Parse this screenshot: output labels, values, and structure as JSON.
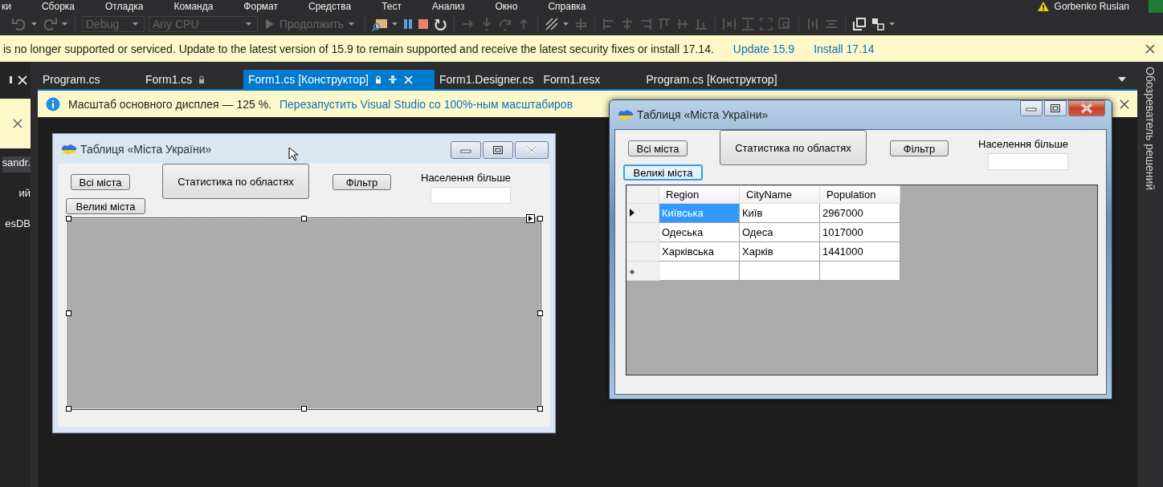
{
  "menu": [
    "ки",
    "Сборка",
    "Отладка",
    "Команда",
    "Формат",
    "Средства",
    "Тест",
    "Анализ",
    "Окно",
    "Справка"
  ],
  "user": {
    "name": "Gorbenko Ruslan"
  },
  "toolbar": {
    "configuration": "Debug",
    "platform": "Any CPU",
    "continue": "Продолжить"
  },
  "notification": {
    "text": "is no longer supported or serviced. Update to the latest version of 15.9 to remain supported and receive the latest security fixes or install 17.14.",
    "links": [
      "Update 15.9",
      "Install 17.14"
    ]
  },
  "left_panel": {
    "items": [
      {
        "text": "sandr.",
        "selected": true
      },
      {
        "text": "ий",
        "selected": false
      },
      {
        "text": "esDB",
        "selected": false
      }
    ]
  },
  "tabs": [
    {
      "label": "Program.cs",
      "selected": false,
      "locked": false
    },
    {
      "label": "Form1.cs",
      "selected": false,
      "locked": true
    },
    {
      "label": "Form1.cs [Конструктор]",
      "selected": true,
      "locked": true
    },
    {
      "label": "Form1.Designer.cs",
      "selected": false,
      "locked": false
    },
    {
      "label": "Form1.resx",
      "selected": false,
      "locked": false
    },
    {
      "label": "Program.cs [Конструктор]",
      "selected": false,
      "locked": false
    }
  ],
  "info_bar": {
    "text": "Масштаб основного дисплея — 125 %.",
    "link": "Перезапустить Visual Studio со 100%-ным масштабиров"
  },
  "side_panel": {
    "title": "Обозреватель решений"
  },
  "windows": [
    {
      "kind": "designer",
      "title": "Таблиця «Міста України»",
      "buttons": [
        {
          "label": "Всі міста",
          "focused": false
        },
        {
          "label": "Статистика по областях",
          "focused": false
        },
        {
          "label": "Фільтр",
          "focused": false
        },
        {
          "label": "Великі міста",
          "focused": false
        }
      ],
      "label": "Населення більше"
    },
    {
      "kind": "running",
      "title": "Таблиця «Міста України»",
      "buttons": [
        {
          "label": "Всі міста",
          "focused": false
        },
        {
          "label": "Статистика по областях",
          "focused": false
        },
        {
          "label": "Фільтр",
          "focused": false
        },
        {
          "label": "Великі міста",
          "focused": true
        }
      ],
      "label": "Населення більше",
      "grid": {
        "columns": [
          "Region",
          "CityName",
          "Population"
        ],
        "rows": [
          {
            "kind": "data",
            "current": true,
            "cells": [
              {
                "text": "Київська",
                "selected": true
              },
              {
                "text": "Київ",
                "selected": false
              },
              {
                "text": "2967000",
                "selected": false
              }
            ]
          },
          {
            "kind": "data",
            "current": false,
            "cells": [
              {
                "text": "Одеська",
                "selected": false
              },
              {
                "text": "Одеса",
                "selected": false
              },
              {
                "text": "1017000",
                "selected": false
              }
            ]
          },
          {
            "kind": "data",
            "current": false,
            "cells": [
              {
                "text": "Харківська",
                "selected": false
              },
              {
                "text": "Харків",
                "selected": false
              },
              {
                "text": "1441000",
                "selected": false
              }
            ]
          },
          {
            "kind": "new",
            "current": false,
            "cells": [
              {
                "text": "",
                "selected": false
              },
              {
                "text": "",
                "selected": false
              },
              {
                "text": "",
                "selected": false
              }
            ]
          }
        ]
      }
    }
  ]
}
